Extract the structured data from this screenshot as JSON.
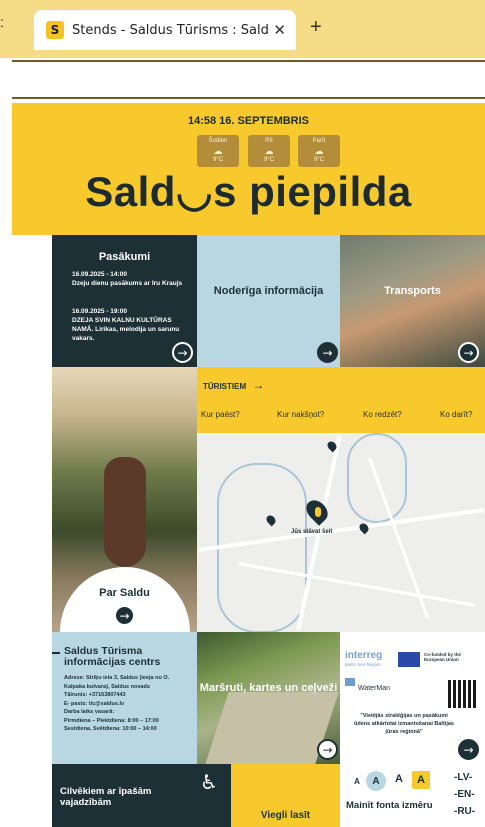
{
  "browser": {
    "tab_title": "Stends - Saldus Tūrisms : Saldus",
    "favicon_letter": "S",
    "close_glyph": "✕",
    "new_tab_glyph": "+",
    "left_fragment": ":"
  },
  "header": {
    "datetime": "14:58  16. SEPTEMBRIS",
    "weather": [
      {
        "day": "Šodien",
        "temp": "9°C"
      },
      {
        "day": "Rīt",
        "temp": "9°C"
      },
      {
        "day": "Parīt",
        "temp": "9°C"
      }
    ],
    "brand": "Sald◡s piepilda"
  },
  "events": {
    "title": "Pasākumi",
    "items": [
      {
        "date": "16.09.2025 - 14:00",
        "text": "Dzeju dienu pasākums ar Iru Kraujs"
      },
      {
        "date": "16.09.2025 - 19:00",
        "text": "DZEJA SVIN KALNU KULTŪRAS NAMĀ. Lirikas, melodija un sarunu vakars."
      }
    ]
  },
  "useful_info": {
    "label": "Noderīga informācija"
  },
  "transport": {
    "label": "Transports"
  },
  "tourists": {
    "heading": "TŪRISTIEM",
    "links": [
      "Kur paēst?",
      "Kur nakšņot?",
      "Ko redzēt?",
      "Ko darīt?"
    ]
  },
  "map": {
    "you_are_here": "Jūs stāvat šeit"
  },
  "about": {
    "label": "Par Saldu"
  },
  "tic": {
    "title_line1": "Saldus Tūrisma",
    "title_line2": "informācijas centrs",
    "lines": [
      "Adrese: Striķu iela 3, Saldus (ieeja no O.",
      "Kalpaka bulvara), Saldus novads",
      "Tālrunis: +37163807443",
      "E- pasts: tic@saldus.lv",
      "Darba laiks vasarā:",
      "Pirmdiena – Piektdiena: 8:00 – 17:00",
      "Sestdiena, Svētdiena: 10:00 – 14:00"
    ]
  },
  "routes": {
    "label": "Maršruti, kartes un ceļveži"
  },
  "interreg": {
    "logo": "interreg",
    "subline": "Baltic Sea Region",
    "eu_text": "Co-funded by the European Union",
    "project": "WaterMan",
    "caption": "\"Vietējās stratēģijas un pasākumi ūdens atkārtotai izmantošanai Baltijas jūras reģionā\""
  },
  "accessibility": {
    "label": "Cilvēkiem ar īpašām vajadzībām"
  },
  "easy_read": {
    "label": "Viegli lasīt"
  },
  "font": {
    "buttons": [
      "A",
      "A",
      "A",
      "A"
    ],
    "label": "Mainīt fonta izmēru"
  },
  "languages": [
    "-LV-",
    "-EN-",
    "-RU-"
  ],
  "colors": {
    "brand_yellow": "#f8c92c",
    "dark": "#1d3036",
    "light_blue": "#b9d7e2"
  }
}
